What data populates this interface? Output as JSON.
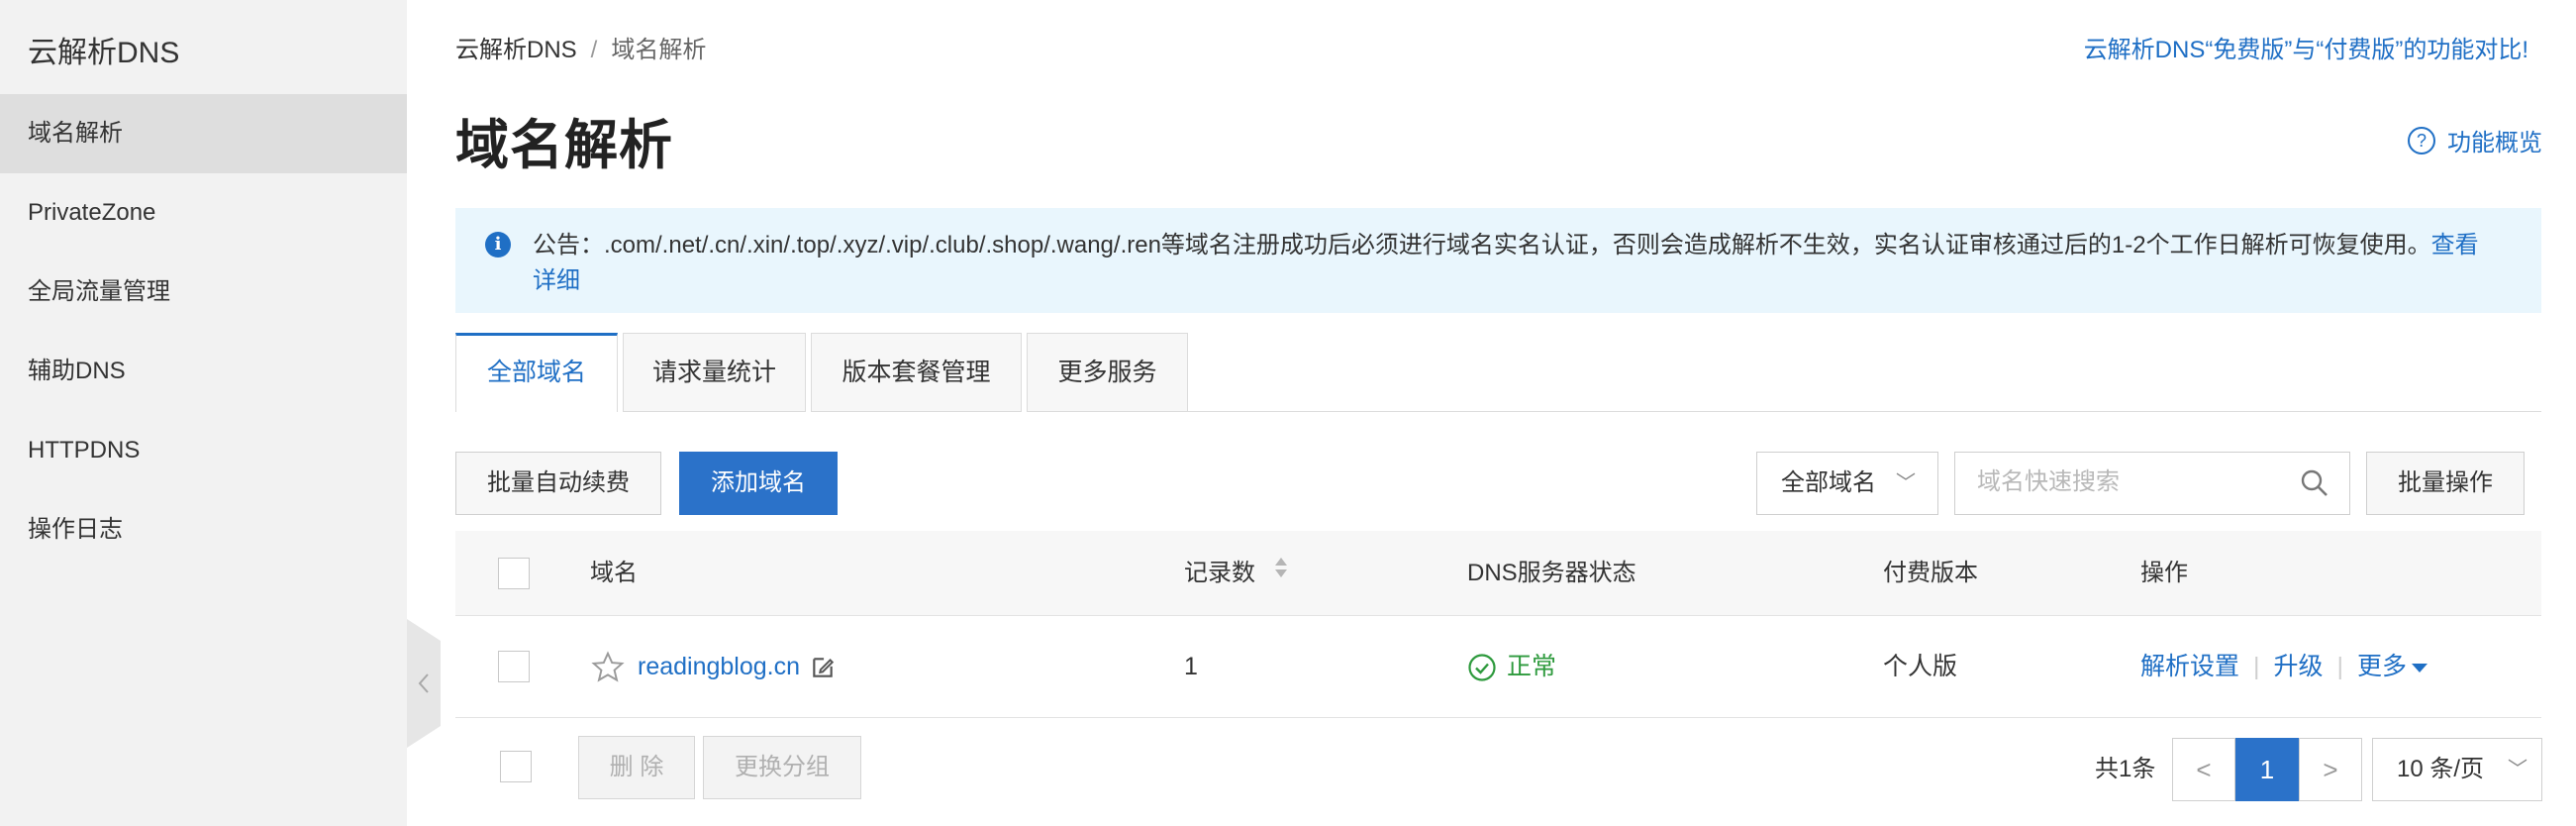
{
  "sidebar": {
    "title": "云解析DNS",
    "items": [
      {
        "label": "域名解析",
        "active": true
      },
      {
        "label": "PrivateZone"
      },
      {
        "label": "全局流量管理"
      },
      {
        "label": "辅助DNS"
      },
      {
        "label": "HTTPDNS"
      },
      {
        "label": "操作日志"
      }
    ]
  },
  "breadcrumb": [
    "云解析DNS",
    "域名解析"
  ],
  "breadcrumb_separator": "/",
  "header": {
    "compare_link": "云解析DNS“免费版”与“付费版”的功能对比!",
    "title": "域名解析",
    "overview_link": "功能概览",
    "overview_icon": "question-circle-icon"
  },
  "notice": {
    "icon": "info-icon",
    "text": "公告：.com/.net/.cn/.xin/.top/.xyz/.vip/.club/.shop/.wang/.ren等域名注册成功后必须进行域名实名认证，否则会造成解析不生效，实名认证审核通过后的1-2个工作日解析可恢复使用。",
    "link": "查看详细"
  },
  "tabs": [
    "全部域名",
    "请求量统计",
    "版本套餐管理",
    "更多服务"
  ],
  "toolbar": {
    "auto_renew": "批量自动续费",
    "add_domain": "添加域名",
    "filter_value": "全部域名",
    "search_placeholder": "域名快速搜索",
    "batch_ops": "批量操作"
  },
  "table": {
    "columns": [
      "域名",
      "记录数",
      "DNS服务器状态",
      "付费版本",
      "操作"
    ],
    "rows": [
      {
        "domain": "readingblog.cn",
        "records": "1",
        "dns_status": "正常",
        "edition": "个人版",
        "actions": [
          "解析设置",
          "升级",
          "更多"
        ]
      }
    ]
  },
  "footer": {
    "delete": "删 除",
    "change_group": "更换分组",
    "total": "共1条",
    "prev": "<",
    "page": "1",
    "next": ">",
    "page_size": "10 条/页"
  },
  "colors": {
    "accent": "#2b72c9",
    "link": "#1f6fc5",
    "success": "#2e9a3d",
    "notice_bg": "#e9f6fd",
    "sidebar_bg": "#f2f2f2"
  }
}
